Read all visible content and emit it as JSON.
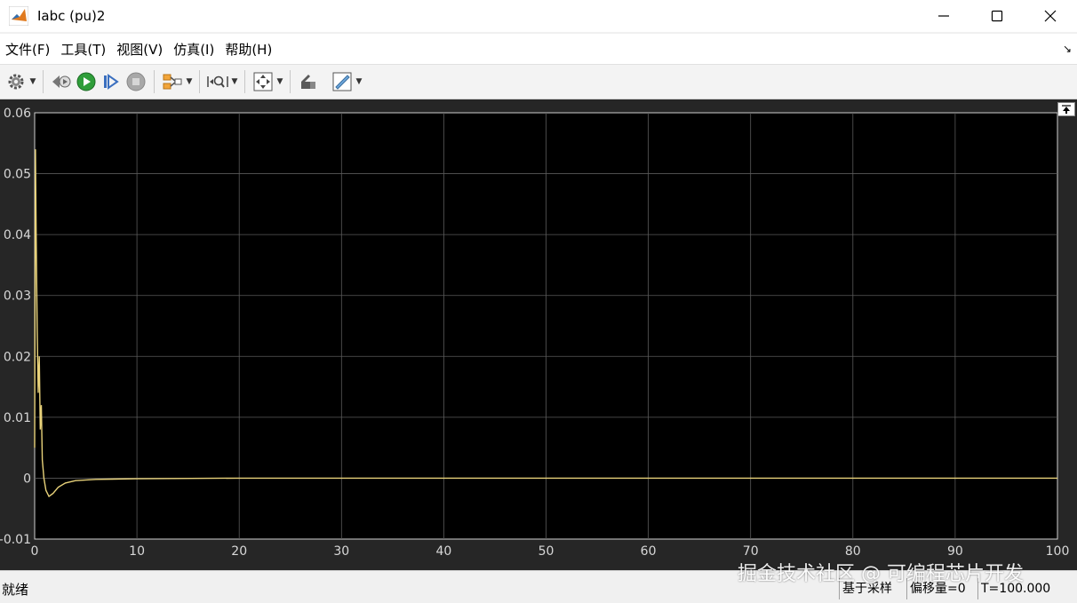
{
  "window": {
    "title": "Iabc (pu)2",
    "app_icon": "matlab-icon",
    "controls": [
      "minimize-icon",
      "maximize-icon",
      "close-icon"
    ]
  },
  "menu": {
    "items": [
      "文件(F)",
      "工具(T)",
      "视图(V)",
      "仿真(I)",
      "帮助(H)"
    ],
    "pin_glyph": "↘"
  },
  "toolbar": {
    "icons": [
      "settings-icon",
      "step-back-icon",
      "run-icon",
      "step-forward-icon",
      "stop-icon",
      "signal-select-icon",
      "zoom-icon",
      "fit-to-view-icon",
      "write-data-icon",
      "measure-icon"
    ]
  },
  "chart_data": {
    "type": "line",
    "xlim": [
      0,
      100
    ],
    "ylim": [
      -0.01,
      0.06
    ],
    "x_ticks": [
      0,
      10,
      20,
      30,
      40,
      50,
      60,
      70,
      80,
      90,
      100
    ],
    "y_ticks": [
      -0.01,
      0,
      0.01,
      0.02,
      0.03,
      0.04,
      0.05,
      0.06
    ],
    "x_tick_labels": [
      "0",
      "10",
      "20",
      "30",
      "40",
      "50",
      "60",
      "70",
      "80",
      "90",
      "100"
    ],
    "y_tick_labels": [
      "-0.01",
      "0",
      "0.01",
      "0.02",
      "0.03",
      "0.04",
      "0.05",
      "0.06"
    ],
    "grid": true,
    "background": "#000000",
    "line_color": "#e8d27a",
    "series": [
      {
        "x": [
          0,
          0.08,
          0.15,
          0.25,
          0.35,
          0.45,
          0.55,
          0.65,
          0.75,
          0.9,
          1.1,
          1.4,
          1.8,
          2.3,
          3,
          4,
          6,
          10,
          20,
          40,
          60,
          80,
          100
        ],
        "values": [
          0.005,
          0.054,
          0.04,
          0.024,
          0.014,
          0.02,
          0.008,
          0.012,
          0.003,
          0.0,
          -0.002,
          -0.003,
          -0.0025,
          -0.0015,
          -0.0008,
          -0.0004,
          -0.0002,
          -0.0001,
          0,
          0,
          0,
          0,
          0
        ]
      }
    ]
  },
  "status": {
    "ready": "就绪",
    "sample_based": "基于采样",
    "offset": "偏移量=0",
    "time": "T=100.000"
  },
  "watermark": "掘金技术社区 @ 可编程芯片开发"
}
